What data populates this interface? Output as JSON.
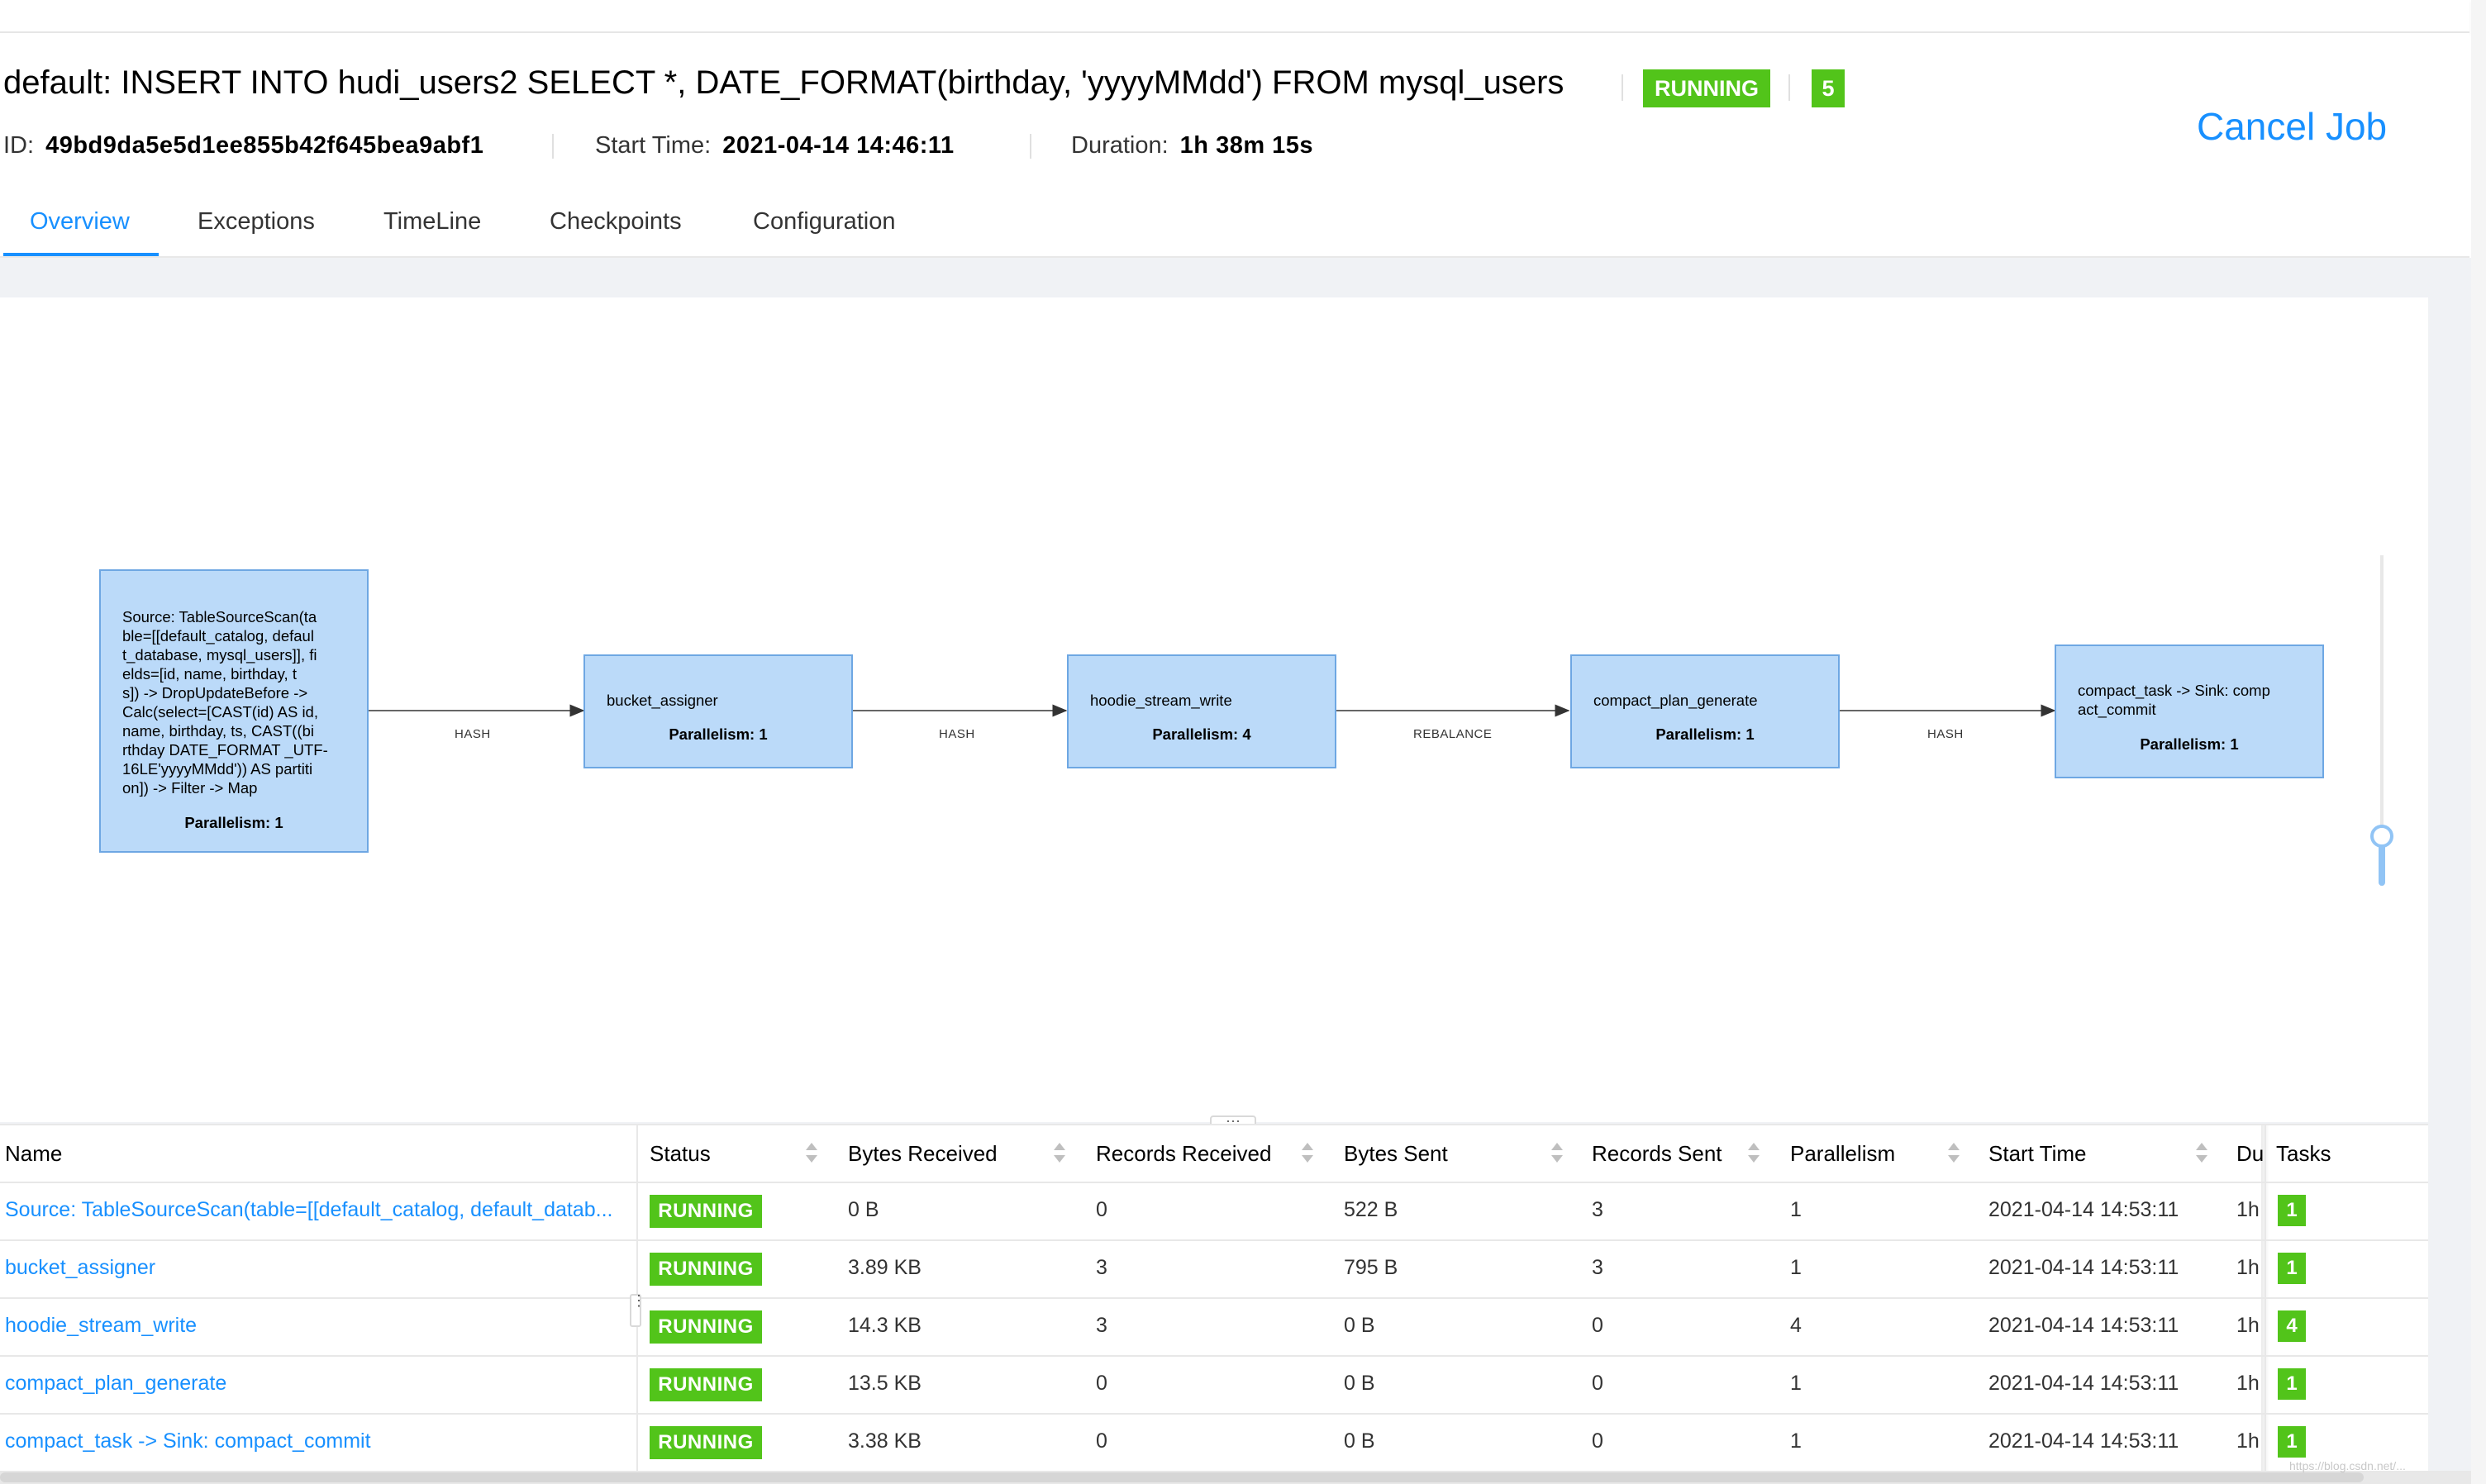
{
  "job": {
    "title": "default: INSERT INTO hudi_users2 SELECT *, DATE_FORMAT(birthday, 'yyyyMMdd') FROM mysql_users",
    "status": "RUNNING",
    "task_count": "5",
    "id_label": "ID:",
    "id": "49bd9da5e5d1ee855b42f645bea9abf1",
    "start_label": "Start Time:",
    "start_time": "2021-04-14 14:46:11",
    "duration_label": "Duration:",
    "duration": "1h 38m 15s",
    "cancel_label": "Cancel Job"
  },
  "tabs": [
    {
      "label": "Overview",
      "active": true
    },
    {
      "label": "Exceptions"
    },
    {
      "label": "TimeLine"
    },
    {
      "label": "Checkpoints"
    },
    {
      "label": "Configuration"
    }
  ],
  "graph": {
    "nodes": [
      {
        "lines": [
          "Source: TableSourceScan(ta",
          "ble=[[default_catalog, defaul",
          "t_database, mysql_users]], fi",
          "elds=[id, name, birthday, t",
          "s]) -> DropUpdateBefore ->",
          "Calc(select=[CAST(id) AS id,",
          "name, birthday, ts, CAST((bi",
          "rthday DATE_FORMAT _UTF-",
          "16LE'yyyyMMdd')) AS partiti",
          "on]) -> Filter -> Map"
        ],
        "parallelism": "Parallelism: 1"
      },
      {
        "lines": [
          "bucket_assigner"
        ],
        "parallelism": "Parallelism: 1"
      },
      {
        "lines": [
          "hoodie_stream_write"
        ],
        "parallelism": "Parallelism: 4"
      },
      {
        "lines": [
          "compact_plan_generate"
        ],
        "parallelism": "Parallelism: 1"
      },
      {
        "lines": [
          "compact_task -> Sink: comp",
          "act_commit"
        ],
        "parallelism": "Parallelism: 1"
      }
    ],
    "edges": [
      "HASH",
      "HASH",
      "REBALANCE",
      "HASH"
    ],
    "resizer": "···"
  },
  "table": {
    "columns": [
      "Name",
      "Status",
      "Bytes Received",
      "Records Received",
      "Bytes Sent",
      "Records Sent",
      "Parallelism",
      "Start Time",
      "Du",
      "Tasks"
    ],
    "rows": [
      {
        "name": "Source: TableSourceScan(table=[[default_catalog, default_datab...",
        "status": "RUNNING",
        "bytes_received": "0 B",
        "records_received": "0",
        "bytes_sent": "522 B",
        "records_sent": "3",
        "parallelism": "1",
        "start_time": "2021-04-14 14:53:11",
        "duration": "1h",
        "tasks": "1"
      },
      {
        "name": "bucket_assigner",
        "status": "RUNNING",
        "bytes_received": "3.89 KB",
        "records_received": "3",
        "bytes_sent": "795 B",
        "records_sent": "3",
        "parallelism": "1",
        "start_time": "2021-04-14 14:53:11",
        "duration": "1h",
        "tasks": "1"
      },
      {
        "name": "hoodie_stream_write",
        "status": "RUNNING",
        "bytes_received": "14.3 KB",
        "records_received": "3",
        "bytes_sent": "0 B",
        "records_sent": "0",
        "parallelism": "4",
        "start_time": "2021-04-14 14:53:11",
        "duration": "1h",
        "tasks": "4"
      },
      {
        "name": "compact_plan_generate",
        "status": "RUNNING",
        "bytes_received": "13.5 KB",
        "records_received": "0",
        "bytes_sent": "0 B",
        "records_sent": "0",
        "parallelism": "1",
        "start_time": "2021-04-14 14:53:11",
        "duration": "1h",
        "tasks": "1"
      },
      {
        "name": "compact_task -> Sink: compact_commit",
        "status": "RUNNING",
        "bytes_received": "3.38 KB",
        "records_received": "0",
        "bytes_sent": "0 B",
        "records_sent": "0",
        "parallelism": "1",
        "start_time": "2021-04-14 14:53:11",
        "duration": "1h",
        "tasks": "1"
      }
    ]
  },
  "watermark": "https://blog.csdn.net/...",
  "colors": {
    "accent": "#1890ff",
    "running": "#52c41a",
    "node_fill": "#bbdaf9",
    "node_border": "#6ea7e3"
  }
}
